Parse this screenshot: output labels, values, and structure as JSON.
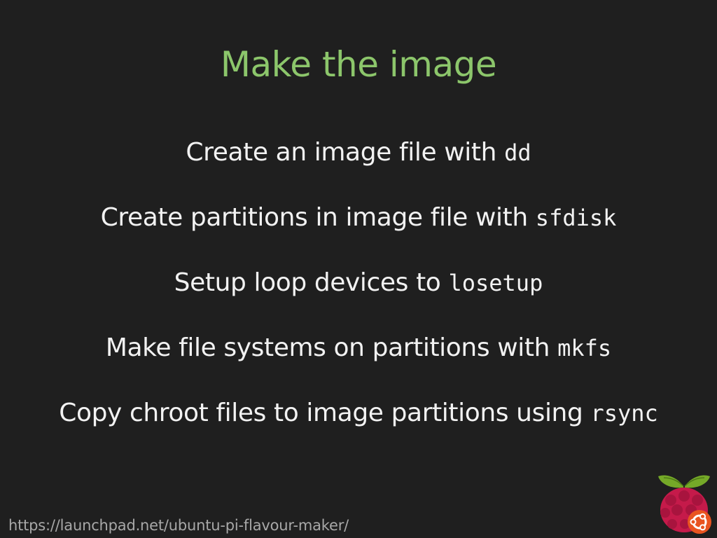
{
  "slide": {
    "title": "Make the image",
    "bullets": [
      {
        "text": "Create an image file with ",
        "code": "dd"
      },
      {
        "text": "Create partitions in image file with ",
        "code": "sfdisk"
      },
      {
        "text": "Setup loop devices to ",
        "code": "losetup"
      },
      {
        "text": "Make file systems on partitions with ",
        "code": "mkfs"
      },
      {
        "text": "Copy chroot files to image partitions using ",
        "code": "rsync"
      }
    ],
    "footer_url": "https://launchpad.net/ubuntu-pi-flavour-maker/",
    "logo_icon": "raspberry-pi-ubuntu-logo-icon"
  },
  "colors": {
    "background": "#1f1f1f",
    "title": "#8cc66b",
    "body_text": "#f2f2f2",
    "footer_text": "#a8a8a8",
    "raspberry": "#c51a4a",
    "leaf": "#75a928",
    "ubuntu_orange": "#e95420"
  }
}
